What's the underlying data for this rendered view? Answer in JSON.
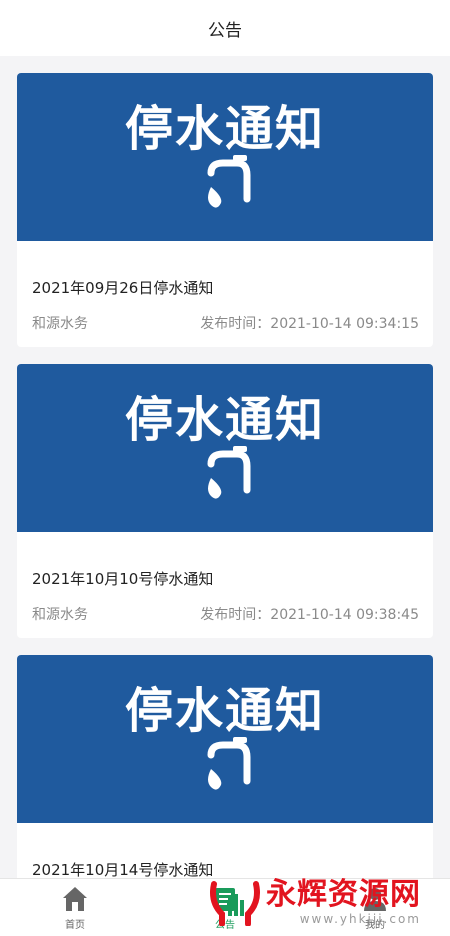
{
  "header": {
    "title": "公告"
  },
  "notices": [
    {
      "banner_text": "停水通知",
      "title": "2021年09月26日停水通知",
      "source": "和源水务",
      "published": "发布时间：2021-10-14 09:34:15"
    },
    {
      "banner_text": "停水通知",
      "title": "2021年10月10号停水通知",
      "source": "和源水务",
      "published": "发布时间：2021-10-14 09:38:45"
    },
    {
      "banner_text": "停水通知",
      "title": "2021年10月14号停水通知",
      "source": "",
      "published": ""
    }
  ],
  "tabbar": {
    "tabs": [
      {
        "label": "首页",
        "icon": "home-icon",
        "active": false
      },
      {
        "label": "公告",
        "icon": "notice-icon",
        "active": true
      },
      {
        "label": "我的",
        "icon": "user-icon",
        "active": false
      }
    ]
  },
  "watermark": {
    "title": "永辉资源网",
    "url": "www.yhkjjj.com"
  },
  "colors": {
    "banner_blue": "#1f5a9e",
    "active_tab": "#1a9b5b",
    "watermark_red": "#e2141f"
  }
}
